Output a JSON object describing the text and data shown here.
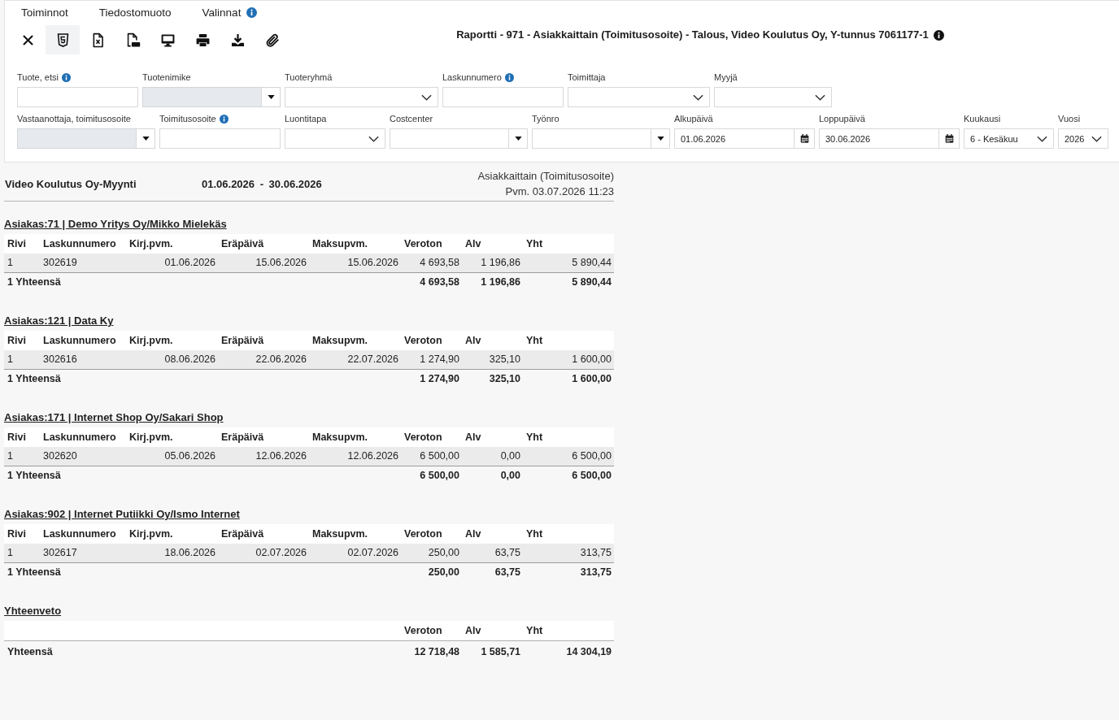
{
  "menu": [
    {
      "label": "Toiminnot",
      "info": false
    },
    {
      "label": "Tiedostomuoto",
      "info": false
    },
    {
      "label": "Valinnat",
      "info": true
    }
  ],
  "toolbar": [
    {
      "kind": "close",
      "selected": false
    },
    {
      "kind": "html",
      "selected": true
    },
    {
      "kind": "excel",
      "selected": false
    },
    {
      "kind": "pdf",
      "selected": false
    },
    {
      "kind": "screen",
      "selected": false
    },
    {
      "kind": "print",
      "selected": false
    },
    {
      "kind": "download",
      "selected": false
    },
    {
      "kind": "attach",
      "selected": false
    }
  ],
  "title": {
    "text": "Raportti - 971 - Asiakkaittain (Toimitusosoite) - Talous, Video Koulutus Oy, Y-tunnus 7061177-1",
    "info": true
  },
  "filters": {
    "rows": [
      [
        {
          "label": "Tuote, etsi",
          "info": true,
          "kind": "text",
          "disabled": false
        },
        {
          "label": "Tuotenimike",
          "info": false,
          "kind": "combo",
          "disabled": true
        },
        {
          "label": "Tuoteryhmä",
          "info": false,
          "kind": "select",
          "disabled": false
        },
        {
          "label": "Laskunnumero",
          "info": true,
          "kind": "text",
          "disabled": false
        },
        {
          "label": "Toimittaja",
          "info": false,
          "kind": "select",
          "disabled": false
        },
        {
          "label": "Myyjä",
          "info": false,
          "kind": "select",
          "disabled": false
        }
      ],
      [
        {
          "label": "Vastaanottaja, toimitusosoite",
          "info": false,
          "kind": "combo",
          "disabled": true
        },
        {
          "label": "Toimitusosoite",
          "info": true,
          "kind": "text",
          "disabled": false
        },
        {
          "label": "Luontitapa",
          "info": false,
          "kind": "select",
          "disabled": false
        },
        {
          "label": "Costcenter",
          "info": false,
          "kind": "combo",
          "disabled": false
        },
        {
          "label": "Työnro",
          "info": false,
          "kind": "combo",
          "disabled": false
        },
        {
          "label": "Alkupäivä",
          "info": false,
          "kind": "date",
          "disabled": false,
          "value": "01.06.2026"
        },
        {
          "label": "Loppupäivä",
          "info": false,
          "kind": "date",
          "disabled": false,
          "value": "30.06.2026"
        },
        {
          "label": "Kuukausi",
          "info": false,
          "kind": "select",
          "disabled": false,
          "value": "6 - Kesäkuu"
        },
        {
          "label": "Vuosi",
          "info": false,
          "kind": "select",
          "disabled": false,
          "value": "2026"
        }
      ]
    ]
  },
  "report": {
    "company": "Video Koulutus Oy-Myynti",
    "period": "01.06.2026 - 30.06.2026",
    "type": "Asiakkaittain (Toimitusosoite)",
    "printed": "Pvm. 03.07.2026 11:23"
  },
  "customers": [
    {
      "heading": "Asiakas:71 | Demo Yritys Oy/Mikko Mielekäs",
      "columns": [
        "Rivi",
        "Laskunnumero",
        "Kirj.pvm.",
        "Eräpäivä",
        "Maksupvm.",
        "Veroton",
        "Alv",
        "Yht"
      ],
      "rows": [
        [
          "1",
          "302619",
          "01.06.2026",
          "15.06.2026",
          "15.06.2026",
          "4 693,58",
          "1 196,86",
          "5 890,44"
        ]
      ],
      "total": {
        "label": "1 Yhteensä",
        "veroton": "4 693,58",
        "alv": "1 196,86",
        "yht": "5 890,44"
      }
    },
    {
      "heading": "Asiakas:121 | Data Ky",
      "columns": [
        "Rivi",
        "Laskunnumero",
        "Kirj.pvm.",
        "Eräpäivä",
        "Maksupvm.",
        "Veroton",
        "Alv",
        "Yht"
      ],
      "rows": [
        [
          "1",
          "302616",
          "08.06.2026",
          "22.06.2026",
          "22.07.2026",
          "1 274,90",
          "325,10",
          "1 600,00"
        ]
      ],
      "total": {
        "label": "1 Yhteensä",
        "veroton": "1 274,90",
        "alv": "325,10",
        "yht": "1 600,00"
      }
    },
    {
      "heading": "Asiakas:171 | Internet Shop Oy/Sakari Shop",
      "columns": [
        "Rivi",
        "Laskunnumero",
        "Kirj.pvm.",
        "Eräpäivä",
        "Maksupvm.",
        "Veroton",
        "Alv",
        "Yht"
      ],
      "rows": [
        [
          "1",
          "302620",
          "05.06.2026",
          "12.06.2026",
          "12.06.2026",
          "6 500,00",
          "0,00",
          "6 500,00"
        ]
      ],
      "total": {
        "label": "1 Yhteensä",
        "veroton": "6 500,00",
        "alv": "0,00",
        "yht": "6 500,00"
      }
    },
    {
      "heading": "Asiakas:902 | Internet Putiikki Oy/Ismo Internet",
      "columns": [
        "Rivi",
        "Laskunnumero",
        "Kirj.pvm.",
        "Eräpäivä",
        "Maksupvm.",
        "Veroton",
        "Alv",
        "Yht"
      ],
      "rows": [
        [
          "1",
          "302617",
          "18.06.2026",
          "02.07.2026",
          "02.07.2026",
          "250,00",
          "63,75",
          "313,75"
        ]
      ],
      "total": {
        "label": "1 Yhteensä",
        "veroton": "250,00",
        "alv": "63,75",
        "yht": "313,75"
      }
    }
  ],
  "summary": {
    "heading": "Yhteenveto",
    "columns": [
      "Veroton",
      "Alv",
      "Yht"
    ],
    "total": {
      "label": "Yhteensä",
      "veroton": "12 718,48",
      "alv": "1 585,71",
      "yht": "14 304,19"
    }
  }
}
